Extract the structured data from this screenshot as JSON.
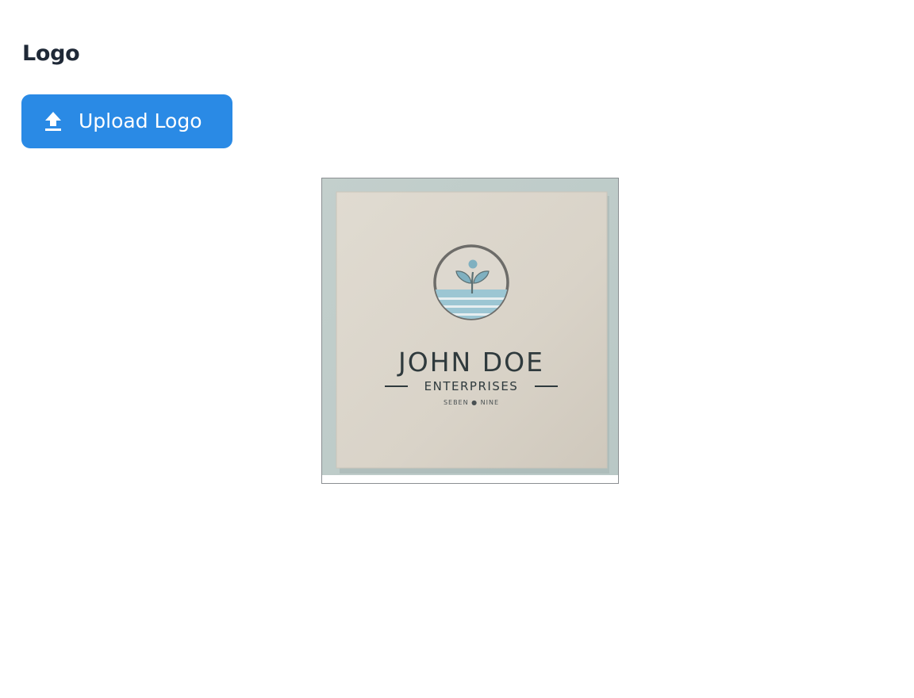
{
  "section": {
    "title": "Logo"
  },
  "upload": {
    "label": "Upload Logo",
    "icon": "upload-icon",
    "color": "#2a8ae5"
  },
  "logo_image": {
    "brand_name": "JOHN DOE",
    "tagline": "ENTERPRISES",
    "subline": "SEBEN  ●  NINE"
  },
  "colors": {
    "heading": "#1f2937",
    "button_background": "#2a8ae5",
    "button_text": "#ffffff",
    "logo_card": "#ddd7cd",
    "logo_accent": "#8fbccb"
  }
}
